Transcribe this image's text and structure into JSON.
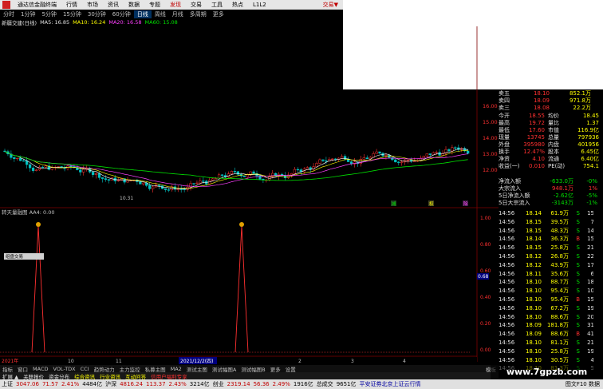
{
  "menu": {
    "app_title": "通达信金融终端",
    "items": [
      "行情",
      "市场",
      "资讯",
      "数据",
      "专题",
      "发现",
      "交易",
      "工具",
      "热点",
      "L1L2"
    ],
    "trade_label": "交易▼"
  },
  "periods": [
    "分时",
    "1分钟",
    "5分钟",
    "15分钟",
    "30分钟",
    "60分钟",
    "日线",
    "周线",
    "月线",
    "多周期",
    "更多"
  ],
  "active_period": "日线",
  "ma_line": {
    "stock": "新疆交建(日线)",
    "ma5": "MA5: 16.85",
    "ma10": "MA10: 16.24",
    "ma20": "MA20: 16.58",
    "ma60": "MA60: 15.08"
  },
  "price_axis": [
    "16.00",
    "15.00",
    "14.00",
    "13.00",
    "12.00"
  ],
  "low_label": "10.31",
  "indicator": {
    "title": "转天量融图 AA4: 0.00",
    "axis": [
      "1.00",
      "0.80",
      "0.60",
      "0.40",
      "0.20",
      "0.00"
    ],
    "side_value": "0.68",
    "tooltip": "组盘交易"
  },
  "date_axis": [
    "2021年",
    "10",
    "11",
    "2021/12/2(四)",
    "2",
    "3",
    "4"
  ],
  "markers": [
    "减",
    "权",
    "除"
  ],
  "quote": {
    "ask": [
      {
        "label": "卖三",
        "price": "18.08",
        "vol": "22.2万"
      },
      {
        "label": "卖四",
        "price": "18.09",
        "vol": "971.8万"
      },
      {
        "label": "卖五",
        "price": "18.10",
        "vol": "852.1万"
      }
    ],
    "stats": [
      {
        "l1": "今开",
        "v1": "18.55",
        "l2": "均价",
        "v2": "18.45"
      },
      {
        "l1": "最高",
        "v1": "19.72",
        "l2": "量比",
        "v2": "1.37"
      },
      {
        "l1": "最低",
        "v1": "17.60",
        "l2": "市值",
        "v2": "116.9亿"
      },
      {
        "l1": "现量",
        "v1": "13745",
        "l2": "总量",
        "v2": "797936"
      },
      {
        "l1": "外盘",
        "v1": "395980",
        "l2": "内盘",
        "v2": "401956"
      },
      {
        "l1": "换手",
        "v1": "12.47%",
        "l2": "股本",
        "v2": "6.45亿"
      },
      {
        "l1": "净资",
        "v1": "4.10",
        "l2": "流通",
        "v2": "6.40亿"
      },
      {
        "l1": "收益(一)",
        "v1": "0.010",
        "l2": "PE(动)",
        "v2": "754.1"
      }
    ],
    "flows": [
      {
        "label": "净流入额",
        "v": "-633.0万",
        "p": "-0%"
      },
      {
        "label": "大宗流入",
        "v": "948.1万",
        "p": "1%"
      },
      {
        "label": "5日净流入额",
        "v": "-2.62亿",
        "p": "-5%"
      },
      {
        "label": "5日大宗流入",
        "v": "-3143万",
        "p": "-1%"
      }
    ],
    "ticks": [
      {
        "t": "14:56",
        "p": "18.14",
        "v": "61.9万",
        "s": "S",
        "n": "15"
      },
      {
        "t": "14:56",
        "p": "18.15",
        "v": "39.5万",
        "s": "S",
        "n": "7"
      },
      {
        "t": "14:56",
        "p": "18.15",
        "v": "48.3万",
        "s": "S",
        "n": "14"
      },
      {
        "t": "14:56",
        "p": "18.14",
        "v": "36.3万",
        "s": "B",
        "n": "15"
      },
      {
        "t": "14:56",
        "p": "18.15",
        "v": "25.8万",
        "s": "S",
        "n": "21"
      },
      {
        "t": "14:56",
        "p": "18.12",
        "v": "26.8万",
        "s": "S",
        "n": "22"
      },
      {
        "t": "14:56",
        "p": "18.12",
        "v": "43.9万",
        "s": "S",
        "n": "17"
      },
      {
        "t": "14:56",
        "p": "18.11",
        "v": "35.6万",
        "s": "S",
        "n": "6"
      },
      {
        "t": "14:56",
        "p": "18.10",
        "v": "88.7万",
        "s": "S",
        "n": "18"
      },
      {
        "t": "14:56",
        "p": "18.10",
        "v": "95.4万",
        "s": "S",
        "n": "10"
      },
      {
        "t": "14:56",
        "p": "18.10",
        "v": "95.4万",
        "s": "B",
        "n": "15"
      },
      {
        "t": "14:56",
        "p": "18.10",
        "v": "67.2万",
        "s": "S",
        "n": "19"
      },
      {
        "t": "14:56",
        "p": "18.10",
        "v": "88.6万",
        "s": "S",
        "n": "20"
      },
      {
        "t": "14:56",
        "p": "18.09",
        "v": "181.8万",
        "s": "S",
        "n": "31"
      },
      {
        "t": "14:56",
        "p": "18.09",
        "v": "88.6万",
        "s": "B",
        "n": "41"
      },
      {
        "t": "14:56",
        "p": "18.10",
        "v": "81.1万",
        "s": "S",
        "n": "21"
      },
      {
        "t": "14:56",
        "p": "18.10",
        "v": "25.8万",
        "s": "S",
        "n": "19"
      },
      {
        "t": "14:56",
        "p": "18.10",
        "v": "30.5万",
        "s": "S",
        "n": "4"
      },
      {
        "t": "14:56",
        "p": "18.10",
        "v": "81.3万",
        "s": "S",
        "n": "5"
      }
    ]
  },
  "tabs1": [
    "指标",
    "窗口",
    "MACD",
    "VOL-TDX",
    "CCI",
    "趋势动力",
    "主力监控",
    "私募主图",
    "MA2",
    "测试主图",
    "测试幅图A",
    "测试幅图B",
    "更多",
    "设置"
  ],
  "tabs1_right": "模板",
  "tabs2": [
    "扩展 ▲",
    "关联报价",
    "资金分布",
    "综合资讯",
    "行业资讯",
    "互动问答",
    "信用户福利专享"
  ],
  "status": {
    "sh_label": "上证",
    "sh_val": "3047.06",
    "sh_chg": "71.57",
    "sh_pct": "2.41%",
    "sh_amt": "4484亿",
    "hs_label": "沪深",
    "hs_val": "4816.24",
    "hs_chg": "113.37",
    "hs_pct": "2.43%",
    "hs_amt": "3214亿",
    "cy_label": "创业",
    "cy_val": "2319.14",
    "cy_chg": "56.36",
    "cy_pct": "2.49%",
    "cy_amt": "1916亿",
    "total_label": "总成交",
    "total_val": "9651亿",
    "news": "平安证券北京上证云行情",
    "right": "图文F10 数据"
  },
  "watermark": "www.7gpzb.com",
  "colors": {
    "up": "#ff3030",
    "down": "#00c0c0",
    "ma5": "#ffffff",
    "ma10": "#ffff00",
    "ma20": "#ff40ff",
    "ma60": "#00e000"
  }
}
